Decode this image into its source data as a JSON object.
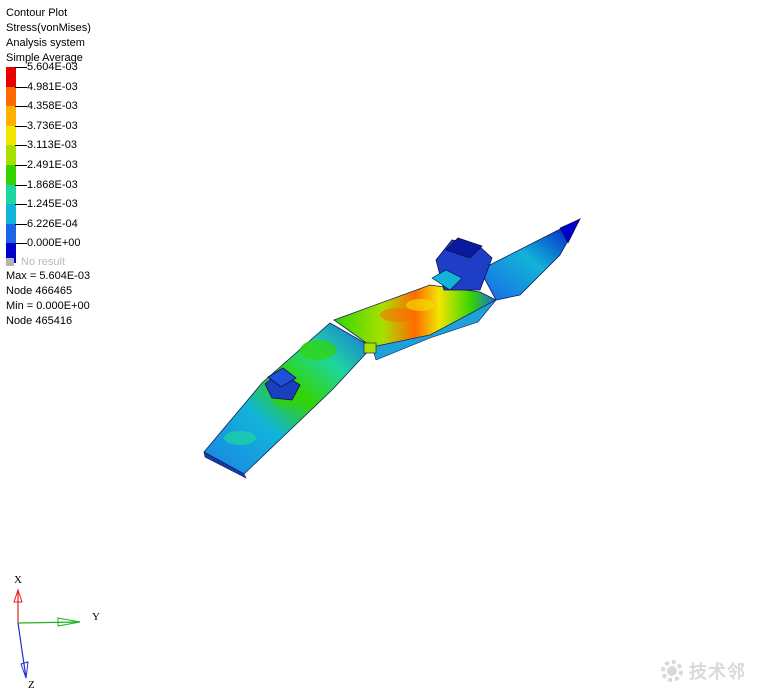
{
  "legend": {
    "title": "Contour Plot",
    "result_type": "Stress(vonMises)",
    "system": "Analysis system",
    "averaging": "Simple Average",
    "levels": [
      "5.604E-03",
      "4.981E-03",
      "4.358E-03",
      "3.736E-03",
      "3.113E-03",
      "2.491E-03",
      "1.868E-03",
      "1.245E-03",
      "6.226E-04",
      "0.000E+00"
    ],
    "colors": [
      "#e60000",
      "#ff6a00",
      "#ffb000",
      "#f2e600",
      "#a8e000",
      "#33d400",
      "#1ed6a0",
      "#12b4d8",
      "#1a66e6",
      "#0000c8"
    ],
    "no_result_label": "No result",
    "no_result_color": "#b4b4b4"
  },
  "summary": {
    "max": "Max = 5.604E-03",
    "max_node": "Node 466465",
    "min": "Min = 0.000E+00",
    "min_node": "Node 465416"
  },
  "triad": {
    "x": "X",
    "y": "Y",
    "z": "Z"
  },
  "watermark": {
    "text": "技术邻"
  }
}
